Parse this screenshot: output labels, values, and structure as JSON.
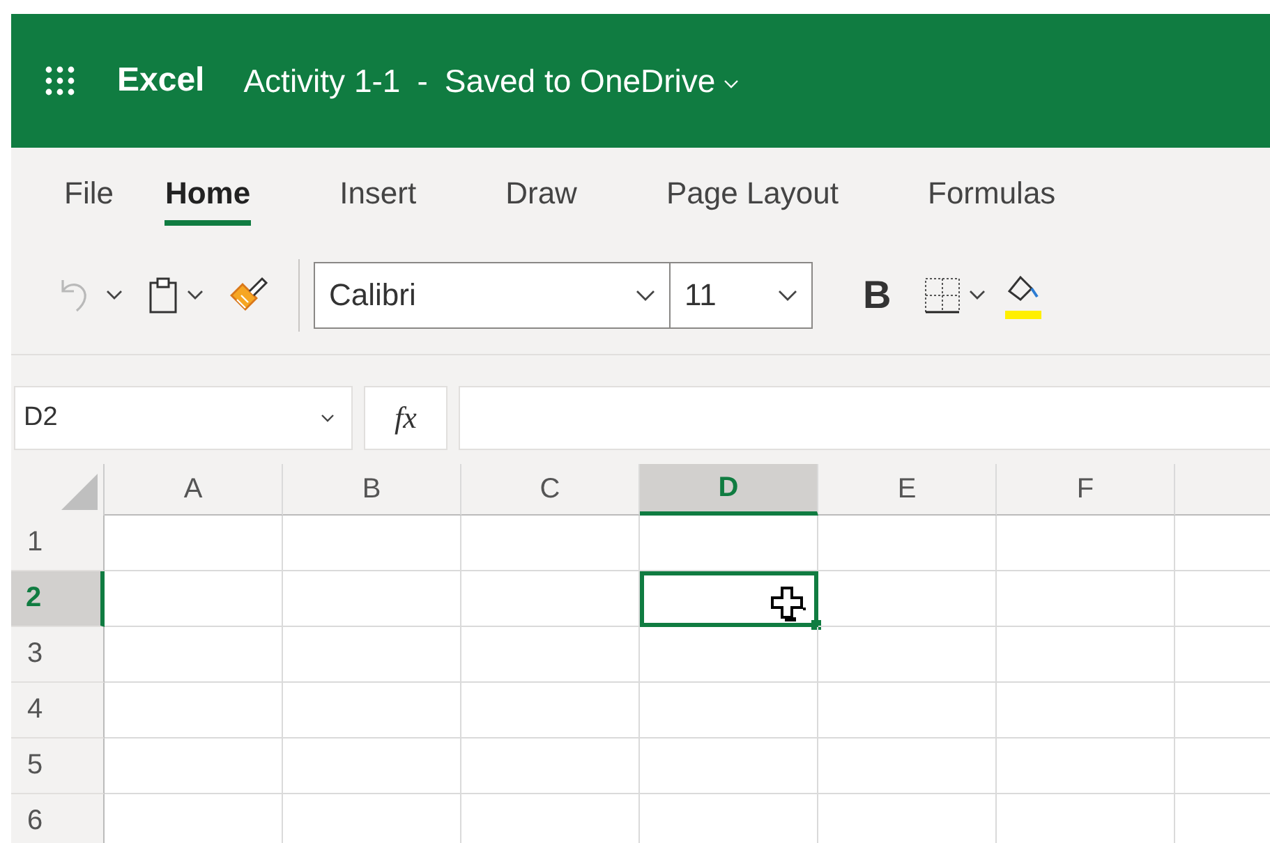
{
  "header": {
    "app_name": "Excel",
    "document_title": "Activity 1-1",
    "separator": "-",
    "save_status": "Saved to OneDrive"
  },
  "tabs": [
    {
      "label": "File",
      "selected": false
    },
    {
      "label": "Home",
      "selected": true
    },
    {
      "label": "Insert",
      "selected": false
    },
    {
      "label": "Draw",
      "selected": false
    },
    {
      "label": "Page Layout",
      "selected": false
    },
    {
      "label": "Formulas",
      "selected": false
    }
  ],
  "toolbar": {
    "font_name": "Calibri",
    "font_size": "11",
    "bold_label": "B"
  },
  "formula_bar": {
    "name_box": "D2",
    "fx_label": "fx"
  },
  "columns": [
    {
      "label": "A",
      "selected": false
    },
    {
      "label": "B",
      "selected": false
    },
    {
      "label": "C",
      "selected": false
    },
    {
      "label": "D",
      "selected": true
    },
    {
      "label": "E",
      "selected": false
    },
    {
      "label": "F",
      "selected": false
    }
  ],
  "rows": [
    {
      "label": "1",
      "selected": false
    },
    {
      "label": "2",
      "selected": true
    },
    {
      "label": "3",
      "selected": false
    },
    {
      "label": "4",
      "selected": false
    },
    {
      "label": "5",
      "selected": false
    },
    {
      "label": "6",
      "selected": false
    }
  ]
}
